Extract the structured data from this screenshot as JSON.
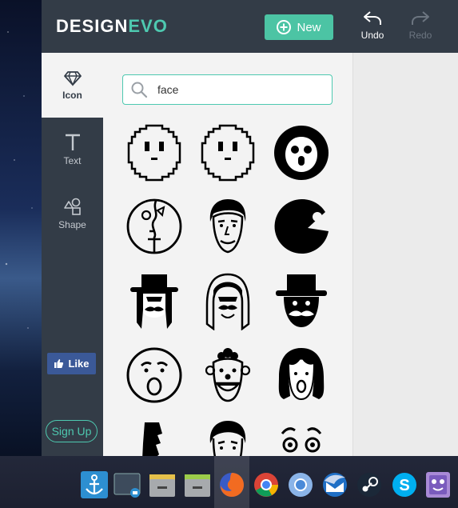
{
  "header": {
    "logo_design": "DESIGN",
    "logo_evo": "EVO",
    "new_label": "New",
    "undo_label": "Undo",
    "redo_label": "Redo"
  },
  "nav": {
    "items": [
      {
        "label": "Icon",
        "icon": "diamond-icon",
        "active": true
      },
      {
        "label": "Text",
        "icon": "text-t-icon",
        "active": false
      },
      {
        "label": "Shape",
        "icon": "shapes-icon",
        "active": false
      }
    ],
    "like_label": "Like",
    "signup_label": "Sign Up"
  },
  "search": {
    "value": "face",
    "icon": "search-icon"
  },
  "icon_results": [
    "pixel-smiley-face-icon",
    "pixel-neutral-face-icon",
    "penguin-face-icon",
    "abstract-face-circle-icon",
    "man-portrait-icon",
    "pacman-face-icon",
    "hat-mustache-man-icon",
    "long-hair-mustache-icon",
    "top-hat-mustache-icon",
    "surprised-face-icon",
    "clown-face-icon",
    "girl-screaming-icon",
    "moai-head-icon",
    "boy-face-icon",
    "eyes-eyebrows-icon"
  ],
  "taskbar": {
    "apps": [
      "dock-anchor-icon",
      "screenshot-icon",
      "file-manager-icon",
      "file-manager-2-icon",
      "firefox-icon",
      "chrome-icon",
      "chromium-icon",
      "thunderbird-icon",
      "steam-icon",
      "skype-icon",
      "app-monster-icon"
    ],
    "active_app": "firefox-icon"
  },
  "colors": {
    "accent": "#4ec9b0",
    "header_bg": "#333c47",
    "like_bg": "#3b5998"
  }
}
